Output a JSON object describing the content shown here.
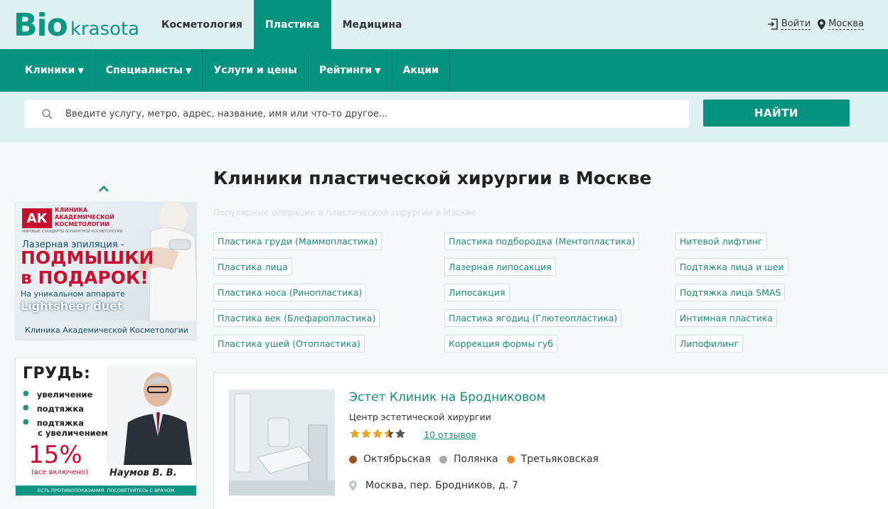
{
  "brand": {
    "part1": "Bio",
    "part2": "krasota",
    "color": "#0e9584"
  },
  "top_tabs": [
    {
      "label": "Косметология",
      "active": false
    },
    {
      "label": "Пластика",
      "active": true
    },
    {
      "label": "Медицина",
      "active": false
    }
  ],
  "top_links": {
    "login": "Войти",
    "city": "Москва"
  },
  "main_nav": [
    {
      "label": "Клиники",
      "has_caret": true
    },
    {
      "label": "Специалисты",
      "has_caret": true
    },
    {
      "label": "Услуги и цены",
      "has_caret": false
    },
    {
      "label": "Рейтинги",
      "has_caret": true
    },
    {
      "label": "Акции",
      "has_caret": false
    }
  ],
  "caret_symbol": "▼",
  "search": {
    "placeholder": "Введите услугу, метро, адрес, название, имя или что-то другое...",
    "button": "НАЙТИ"
  },
  "ads": {
    "ad1": {
      "logo": "АК",
      "clinic_name": "КЛИНИКА АКАДЕМИЧЕСКОЙ КОСМЕТОЛОГИИ",
      "tagline": "МИРОВЫЕ СТАНДАРТЫ АППАРАТНОЙ КОСМЕТОЛОГИИ",
      "line1": "Лазерная эпиляция -",
      "line2": "ПОДМЫШКИ в ПОДАРОК!",
      "line3": "На уникальном аппарате",
      "line4": "Lightsheer duet",
      "footer": "Клиника Академической Косметологии"
    },
    "ad2": {
      "heading": "ГРУДЬ:",
      "bullets": [
        "увеличение",
        "подтяжка",
        "подтяжка",
        "с увеличением"
      ],
      "discount": "15%",
      "included": "(все включено)",
      "doctor": "Наумов В. В.",
      "disclaimer": "ЕСТЬ ПРОТИВОПОКАЗАНИЯ. ПОСОВЕТУЙТЕСЬ С ВРАЧОМ."
    }
  },
  "page": {
    "title": "Клиники пластической хирургии в Москве",
    "popular_label": "Популярные операции в пластической хирургии в Москве"
  },
  "tags": [
    [
      "Пластика груди (Маммопластика)",
      "Пластика подбородка (Ментопластика)",
      "Нитевой лифтинг"
    ],
    [
      "Пластика лица",
      "Лазерная липосакция",
      "Подтяжка лица и шеи"
    ],
    [
      "Пластика носа (Ринопластика)",
      "Липосакция",
      "Подтяжка лица SMAS"
    ],
    [
      "Пластика век (Блефаропластика)",
      "Пластика ягодиц (Глютеопластика)",
      "Интимная пластика"
    ],
    [
      "Пластика ушей (Отопластика)",
      "Коррекция формы губ",
      "Липофилинг"
    ]
  ],
  "clinic": {
    "name": "Эстет Клиник на Бродниковом",
    "type": "Центр эстетической хирургии",
    "rating": 3.5,
    "rating_max": 5,
    "reviews": "10 отзывов",
    "metros": [
      {
        "name": "Октябрьская",
        "color": "#a0522d"
      },
      {
        "name": "Полянка",
        "color": "#a9a9a9"
      },
      {
        "name": "Третьяковская",
        "color": "#f28c28"
      }
    ],
    "address": "Москва, пер. Бродников, д. 7"
  }
}
